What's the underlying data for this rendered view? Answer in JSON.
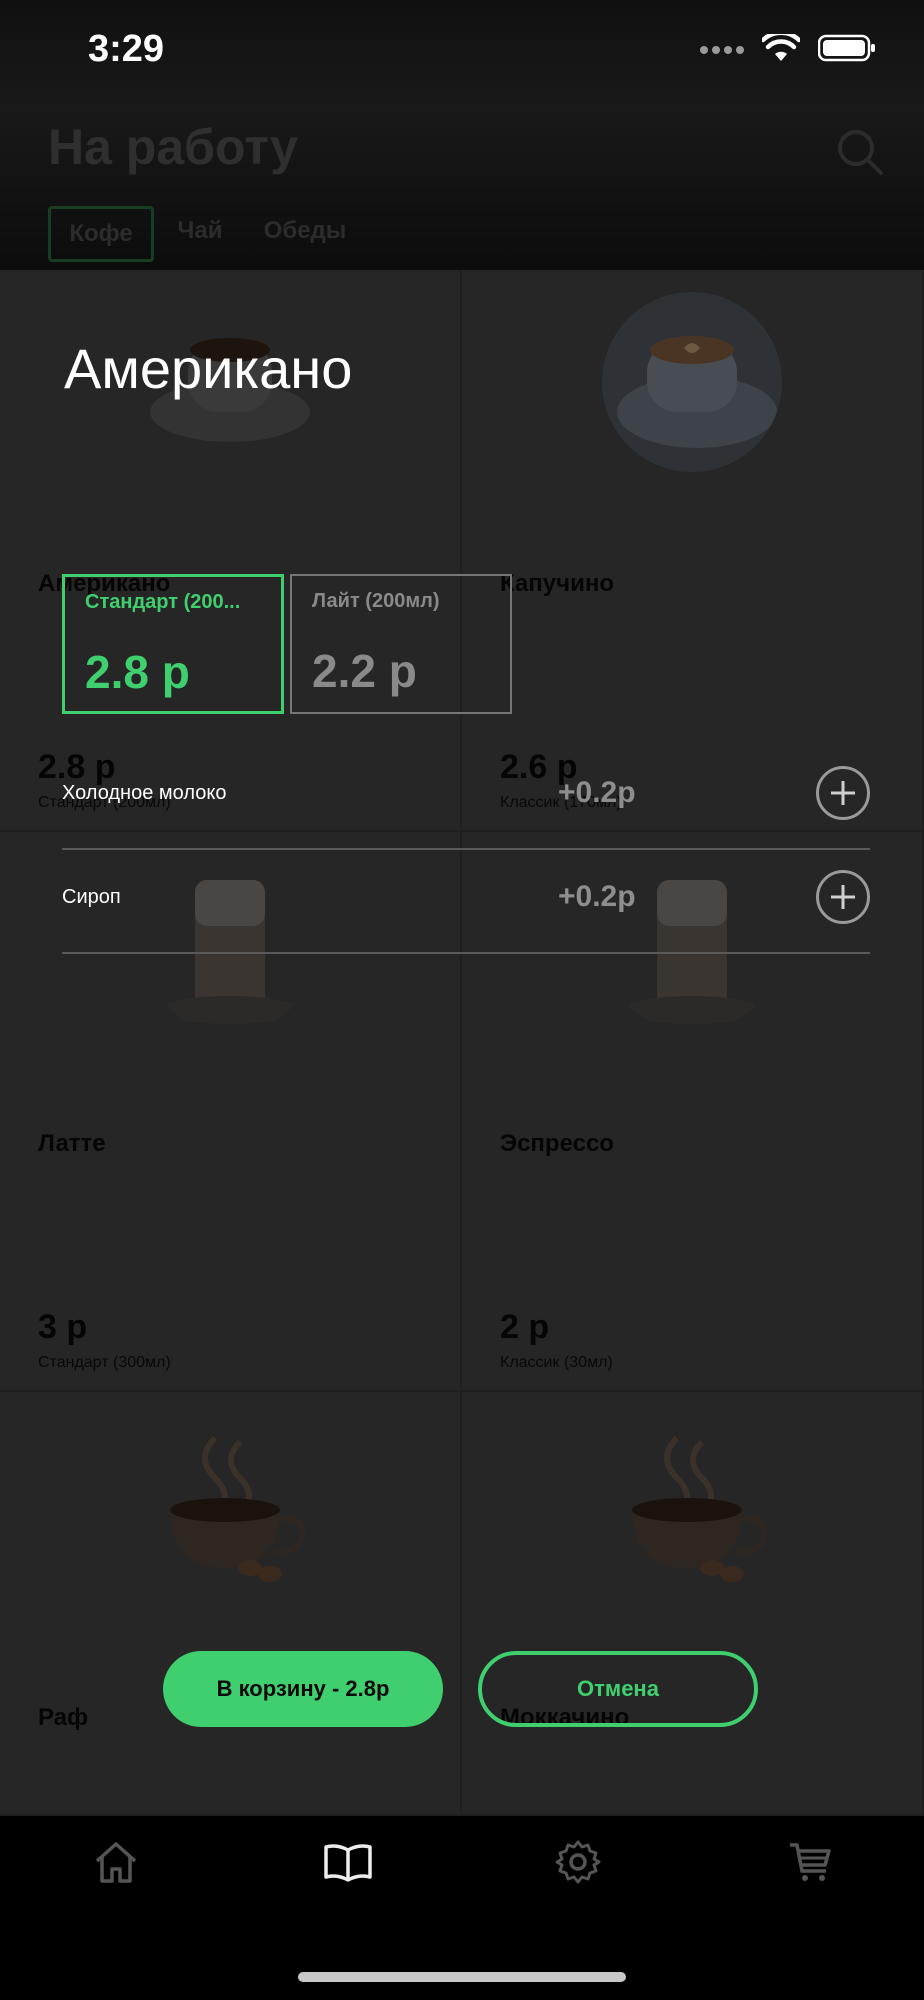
{
  "status_bar": {
    "time": "3:29"
  },
  "header": {
    "title": "На работу",
    "tabs": [
      {
        "label": "Кофе",
        "active": true
      },
      {
        "label": "Чай",
        "active": false
      },
      {
        "label": "Обеды",
        "active": false
      }
    ]
  },
  "products": [
    {
      "name": "Американо",
      "price": "2.8 р",
      "size": "Стандарт (200мл)",
      "image": "americano-cup"
    },
    {
      "name": "Капучино",
      "price": "2.6 р",
      "size": "Классик (170мл)",
      "image": "cappuccino-cup"
    },
    {
      "name": "Латте",
      "price": "3 р",
      "size": "Стандарт (300мл)",
      "image": "latte-glass"
    },
    {
      "name": "Эспрессо",
      "price": "2 р",
      "size": "Классик (30мл)",
      "image": "espresso-glass"
    },
    {
      "name": "Раф",
      "price": "",
      "size": "",
      "image": "coffee-cup-placeholder"
    },
    {
      "name": "Моккачино",
      "price": "",
      "size": "",
      "image": "coffee-cup-placeholder"
    }
  ],
  "modal": {
    "title": "Американо",
    "sizes": [
      {
        "label": "Стандарт (200...",
        "price": "2.8 р",
        "selected": true
      },
      {
        "label": "Лайт (200мл)",
        "price": "2.2 р",
        "selected": false
      }
    ],
    "addons": [
      {
        "name": "Холодное молоко",
        "price": "+0.2р"
      },
      {
        "name": "Сироп",
        "price": "+0.2р"
      }
    ],
    "add_to_cart_label": "В корзину - 2.8р",
    "cancel_label": "Отмена"
  },
  "tabbar": {
    "items": [
      {
        "icon": "home-icon",
        "active": false
      },
      {
        "icon": "book-icon",
        "active": true
      },
      {
        "icon": "gear-icon",
        "active": false
      },
      {
        "icon": "cart-icon",
        "active": false
      }
    ]
  },
  "colors": {
    "accent": "#3fcf6e",
    "background": "#262626",
    "inactive": "#8a8a8a"
  }
}
